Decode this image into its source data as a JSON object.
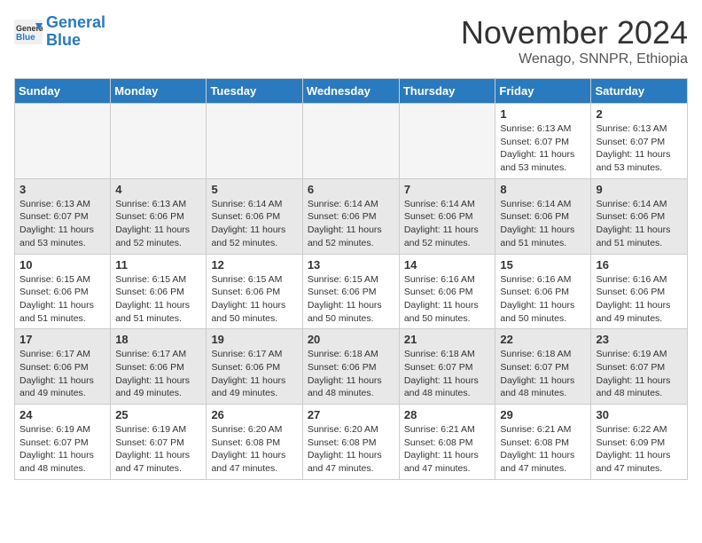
{
  "header": {
    "logo_line1": "General",
    "logo_line2": "Blue",
    "month": "November 2024",
    "location": "Wenago, SNNPR, Ethiopia"
  },
  "days_of_week": [
    "Sunday",
    "Monday",
    "Tuesday",
    "Wednesday",
    "Thursday",
    "Friday",
    "Saturday"
  ],
  "weeks": [
    {
      "shaded": false,
      "days": [
        {
          "date": "",
          "info": ""
        },
        {
          "date": "",
          "info": ""
        },
        {
          "date": "",
          "info": ""
        },
        {
          "date": "",
          "info": ""
        },
        {
          "date": "",
          "info": ""
        },
        {
          "date": "1",
          "info": "Sunrise: 6:13 AM\nSunset: 6:07 PM\nDaylight: 11 hours\nand 53 minutes."
        },
        {
          "date": "2",
          "info": "Sunrise: 6:13 AM\nSunset: 6:07 PM\nDaylight: 11 hours\nand 53 minutes."
        }
      ]
    },
    {
      "shaded": true,
      "days": [
        {
          "date": "3",
          "info": "Sunrise: 6:13 AM\nSunset: 6:07 PM\nDaylight: 11 hours\nand 53 minutes."
        },
        {
          "date": "4",
          "info": "Sunrise: 6:13 AM\nSunset: 6:06 PM\nDaylight: 11 hours\nand 52 minutes."
        },
        {
          "date": "5",
          "info": "Sunrise: 6:14 AM\nSunset: 6:06 PM\nDaylight: 11 hours\nand 52 minutes."
        },
        {
          "date": "6",
          "info": "Sunrise: 6:14 AM\nSunset: 6:06 PM\nDaylight: 11 hours\nand 52 minutes."
        },
        {
          "date": "7",
          "info": "Sunrise: 6:14 AM\nSunset: 6:06 PM\nDaylight: 11 hours\nand 52 minutes."
        },
        {
          "date": "8",
          "info": "Sunrise: 6:14 AM\nSunset: 6:06 PM\nDaylight: 11 hours\nand 51 minutes."
        },
        {
          "date": "9",
          "info": "Sunrise: 6:14 AM\nSunset: 6:06 PM\nDaylight: 11 hours\nand 51 minutes."
        }
      ]
    },
    {
      "shaded": false,
      "days": [
        {
          "date": "10",
          "info": "Sunrise: 6:15 AM\nSunset: 6:06 PM\nDaylight: 11 hours\nand 51 minutes."
        },
        {
          "date": "11",
          "info": "Sunrise: 6:15 AM\nSunset: 6:06 PM\nDaylight: 11 hours\nand 51 minutes."
        },
        {
          "date": "12",
          "info": "Sunrise: 6:15 AM\nSunset: 6:06 PM\nDaylight: 11 hours\nand 50 minutes."
        },
        {
          "date": "13",
          "info": "Sunrise: 6:15 AM\nSunset: 6:06 PM\nDaylight: 11 hours\nand 50 minutes."
        },
        {
          "date": "14",
          "info": "Sunrise: 6:16 AM\nSunset: 6:06 PM\nDaylight: 11 hours\nand 50 minutes."
        },
        {
          "date": "15",
          "info": "Sunrise: 6:16 AM\nSunset: 6:06 PM\nDaylight: 11 hours\nand 50 minutes."
        },
        {
          "date": "16",
          "info": "Sunrise: 6:16 AM\nSunset: 6:06 PM\nDaylight: 11 hours\nand 49 minutes."
        }
      ]
    },
    {
      "shaded": true,
      "days": [
        {
          "date": "17",
          "info": "Sunrise: 6:17 AM\nSunset: 6:06 PM\nDaylight: 11 hours\nand 49 minutes."
        },
        {
          "date": "18",
          "info": "Sunrise: 6:17 AM\nSunset: 6:06 PM\nDaylight: 11 hours\nand 49 minutes."
        },
        {
          "date": "19",
          "info": "Sunrise: 6:17 AM\nSunset: 6:06 PM\nDaylight: 11 hours\nand 49 minutes."
        },
        {
          "date": "20",
          "info": "Sunrise: 6:18 AM\nSunset: 6:06 PM\nDaylight: 11 hours\nand 48 minutes."
        },
        {
          "date": "21",
          "info": "Sunrise: 6:18 AM\nSunset: 6:07 PM\nDaylight: 11 hours\nand 48 minutes."
        },
        {
          "date": "22",
          "info": "Sunrise: 6:18 AM\nSunset: 6:07 PM\nDaylight: 11 hours\nand 48 minutes."
        },
        {
          "date": "23",
          "info": "Sunrise: 6:19 AM\nSunset: 6:07 PM\nDaylight: 11 hours\nand 48 minutes."
        }
      ]
    },
    {
      "shaded": false,
      "days": [
        {
          "date": "24",
          "info": "Sunrise: 6:19 AM\nSunset: 6:07 PM\nDaylight: 11 hours\nand 48 minutes."
        },
        {
          "date": "25",
          "info": "Sunrise: 6:19 AM\nSunset: 6:07 PM\nDaylight: 11 hours\nand 47 minutes."
        },
        {
          "date": "26",
          "info": "Sunrise: 6:20 AM\nSunset: 6:08 PM\nDaylight: 11 hours\nand 47 minutes."
        },
        {
          "date": "27",
          "info": "Sunrise: 6:20 AM\nSunset: 6:08 PM\nDaylight: 11 hours\nand 47 minutes."
        },
        {
          "date": "28",
          "info": "Sunrise: 6:21 AM\nSunset: 6:08 PM\nDaylight: 11 hours\nand 47 minutes."
        },
        {
          "date": "29",
          "info": "Sunrise: 6:21 AM\nSunset: 6:08 PM\nDaylight: 11 hours\nand 47 minutes."
        },
        {
          "date": "30",
          "info": "Sunrise: 6:22 AM\nSunset: 6:09 PM\nDaylight: 11 hours\nand 47 minutes."
        }
      ]
    }
  ]
}
